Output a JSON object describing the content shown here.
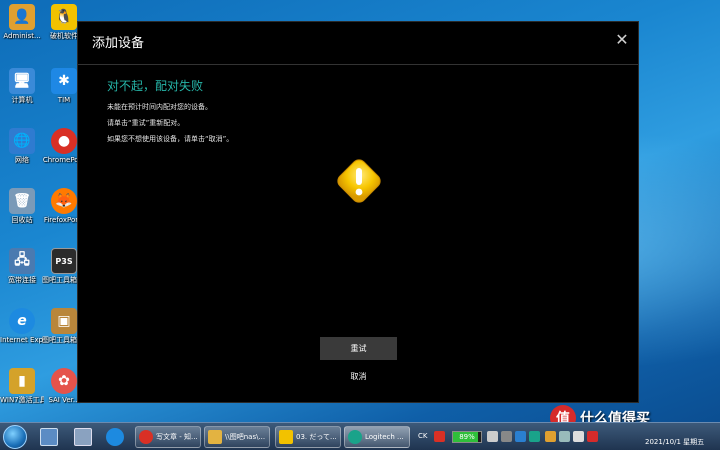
{
  "desktop": {
    "icons": [
      {
        "label": "Administ...",
        "glyph": "👤",
        "color": "#e0a030"
      },
      {
        "label": "破机软件",
        "glyph": "🐧",
        "color": "#f2c200"
      },
      {
        "label": "计算机",
        "glyph": "🖥",
        "color": "#3a8ad8"
      },
      {
        "label": "TIM",
        "glyph": "✱",
        "color": "#1e88e5"
      },
      {
        "label": "网络",
        "glyph": "🌐",
        "color": "#2f7bd0"
      },
      {
        "label": "ChromePo...",
        "glyph": "●",
        "color": "#d93025"
      },
      {
        "label": "回收站",
        "glyph": "🗑",
        "color": "#7a9ab8"
      },
      {
        "label": "FirefoxPor...",
        "glyph": "🦊",
        "color": "#ff7a00"
      },
      {
        "label": "宽带连接",
        "glyph": "🖧",
        "color": "#4a7ab0"
      },
      {
        "label": "图吧工具箱 2019",
        "glyph": "P3S",
        "color": "#2b2b2b"
      },
      {
        "label": "Internet Explorer",
        "glyph": "e",
        "color": "#1d8ae0"
      },
      {
        "label": "图吧工具箱 2020",
        "glyph": "▣",
        "color": "#b9863b"
      },
      {
        "label": "WIN7激活工具",
        "glyph": "▮",
        "color": "#d4a22a"
      },
      {
        "label": "SAI Ver...",
        "glyph": "✿",
        "color": "#e5534b"
      }
    ]
  },
  "dialog": {
    "title": "添加设备",
    "error_heading": "对不起，配对失败",
    "messages": [
      "未能在预计时间内配对您的设备。",
      "请单击“重试”重新配对。",
      "如果您不想使用该设备，请单击“取消”。"
    ],
    "retry_label": "重试",
    "cancel_label": "取消",
    "warning_color": "#f7c600"
  },
  "taskbar": {
    "items": [
      {
        "label": "写文章 - 知...",
        "color": "#d93025"
      },
      {
        "label": "\\\\图吧nas\\...",
        "color": "#e3b341"
      },
      {
        "label": "03. だって...",
        "color": "#f2c200"
      },
      {
        "label": "Logitech ...",
        "color": "#1aa38a"
      }
    ],
    "tray_text": "CK",
    "battery_percent": "89%",
    "battery_level": 0.89,
    "clock_date": "2021/10/1 星期五"
  },
  "watermark": {
    "logo": "值",
    "text": "什么值得买"
  }
}
